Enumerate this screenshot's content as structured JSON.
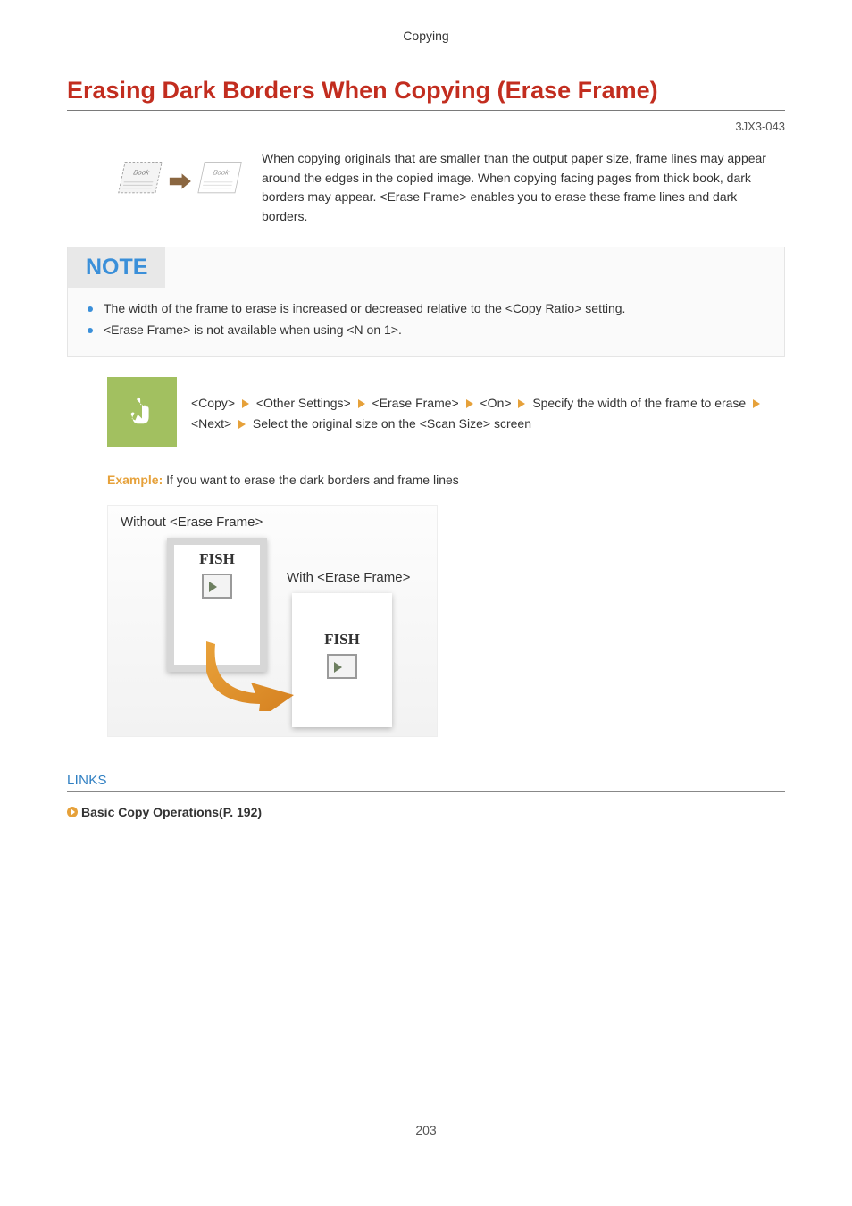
{
  "header": {
    "section": "Copying"
  },
  "title": "Erasing Dark Borders When Copying (Erase Frame)",
  "doc_code": "3JX3-043",
  "intro": "When copying originals that are smaller than the output paper size, frame lines may appear around the edges in the copied image. When copying facing pages from thick book, dark borders may appear. <Erase Frame> enables you to erase these frame lines and dark borders.",
  "note": {
    "label": "NOTE",
    "items": [
      "The width of the frame to erase is increased or decreased relative to the <Copy Ratio> setting.",
      "<Erase Frame> is not available when using <N on 1>."
    ]
  },
  "path": {
    "segments": [
      "<Copy>",
      "<Other Settings>",
      "<Erase Frame>",
      "<On>",
      "Specify the width of the frame to erase",
      "<Next>",
      "Select the original size on the <Scan Size> screen"
    ]
  },
  "example": {
    "label": "Example:",
    "text": "If you want to erase the dark borders and frame lines"
  },
  "figure": {
    "without_label": "Without <Erase Frame>",
    "with_label": "With <Erase Frame>",
    "fish": "FISH"
  },
  "links": {
    "heading": "LINKS",
    "items": [
      "Basic Copy Operations(P. 192)"
    ]
  },
  "page_number": "203"
}
